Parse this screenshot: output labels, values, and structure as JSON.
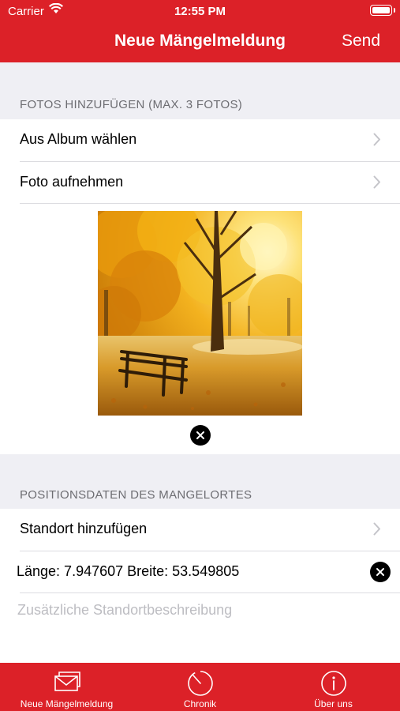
{
  "status_bar": {
    "carrier": "Carrier",
    "time": "12:55 PM"
  },
  "nav": {
    "title": "Neue Mängelmeldung",
    "send_label": "Send"
  },
  "photos_section": {
    "header": "FOTOS HINZUFÜGEN (MAX. 3 FOTOS)",
    "rows": [
      {
        "label": "Aus Album wählen",
        "icon": "chevron-right-icon"
      },
      {
        "label": "Foto aufnehmen",
        "icon": "chevron-right-icon"
      }
    ],
    "photo_count": 1
  },
  "location_section": {
    "header": "POSITIONSDATEN DES MANGELORTES",
    "add_location_label": "Standort hinzufügen",
    "coordinates": "Länge: 7.947607 Breite: 53.549805",
    "description_placeholder": "Zusätzliche Standortbeschreibung"
  },
  "tab_bar": {
    "tabs": [
      {
        "label": "Neue Mängelmeldung",
        "icon": "envelope-icon"
      },
      {
        "label": "Chronik",
        "icon": "timer-icon"
      },
      {
        "label": "Über uns",
        "icon": "info-icon"
      }
    ]
  },
  "colors": {
    "brand_red": "#dc2128",
    "background": "#efeff4",
    "section_header": "#6d6d72"
  }
}
